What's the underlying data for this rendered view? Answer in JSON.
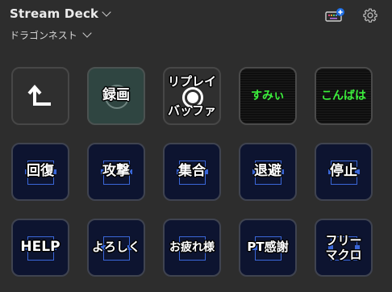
{
  "header": {
    "title": "Stream Deck",
    "profile": "ドラゴンネスト"
  },
  "icons": {
    "keyboard": "keyboard-add-icon",
    "settings": "gear-icon",
    "back": "back-arrow-icon"
  },
  "colors": {
    "background": "#2d2d2d",
    "key_navy": "#0d1430",
    "key_teal": "#2f4541",
    "frame_blue": "#3a67d8",
    "green_text": "#3cf03c",
    "badge_blue": "#1e6fe6"
  },
  "keys": {
    "rec": "録画",
    "replay_1": "リプレイ",
    "replay_2": "バッファ",
    "sumi": "すみぃ",
    "konbaha": "こんばは",
    "kaifuku": "回復",
    "kougeki": "攻撃",
    "shuugou": "集合",
    "taihi": "退避",
    "teishi": "停止",
    "help": "HELP",
    "yoroshiku": "よろしく",
    "otsukare": "お疲れ様",
    "pt": "PT感謝",
    "free_1": "フリー",
    "free_2": "マクロ"
  }
}
